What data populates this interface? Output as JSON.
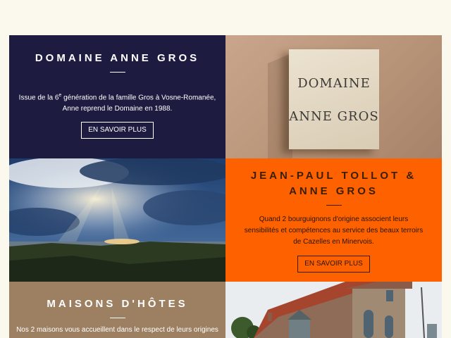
{
  "tiles": {
    "domaine": {
      "title": "DOMAINE ANNE GROS",
      "text_before": "Issue de la 6",
      "superscript": "e",
      "text_after": " génération de la famille Gros à Vosne-Romanée, Anne reprend le Domaine en 1988.",
      "button": "EN SAVOIR PLUS"
    },
    "plaque": {
      "line1": "DOMAINE",
      "line2": "ANNE GROS"
    },
    "tollot": {
      "title": "JEAN-PAUL TOLLOT & ANNE GROS",
      "text": "Quand 2 bourguignons d'origine associent leurs sensibilités et compétences au service des beaux terroirs de Cazelles en Minervois.",
      "button": "EN SAVOIR PLUS"
    },
    "maisons": {
      "title": "MAISONS D'HÔTES",
      "text": "Nos 2 maisons vous accueillent dans le respect de leurs origines"
    }
  },
  "colors": {
    "navy": "#1d1c40",
    "orange": "#fe6200",
    "taupe": "#9d8062",
    "page_background": "#fbf8ee"
  },
  "icons": []
}
